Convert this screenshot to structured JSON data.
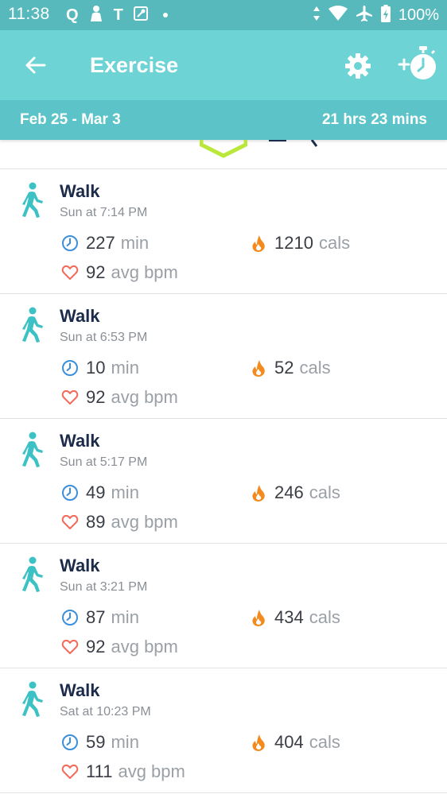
{
  "status_bar": {
    "time": "11:38",
    "left_glyphs": [
      "Q",
      "T"
    ],
    "battery": "100%"
  },
  "app_bar": {
    "title": "Exercise"
  },
  "week_summary": {
    "range": "Feb 25 - Mar 3",
    "total": "21 hrs 23 mins"
  },
  "units": {
    "duration": "min",
    "calories": "cals",
    "heart_rate": "avg bpm"
  },
  "colors": {
    "accent_teal": "#58b9bd",
    "app_bar": "#6dd3d4",
    "walk_icon": "#3cc1c4",
    "clock_icon": "#3b8fd9",
    "flame_icon": "#f28a1e",
    "heart_icon": "#f26b5b"
  },
  "exercises": [
    {
      "type": "Walk",
      "time": "Sun at 7:14 PM",
      "duration": "227",
      "calories": "1210",
      "bpm": "92"
    },
    {
      "type": "Walk",
      "time": "Sun at 6:53 PM",
      "duration": "10",
      "calories": "52",
      "bpm": "92"
    },
    {
      "type": "Walk",
      "time": "Sun at 5:17 PM",
      "duration": "49",
      "calories": "246",
      "bpm": "89"
    },
    {
      "type": "Walk",
      "time": "Sun at 3:21 PM",
      "duration": "87",
      "calories": "434",
      "bpm": "92"
    },
    {
      "type": "Walk",
      "time": "Sat at 10:23 PM",
      "duration": "59",
      "calories": "404",
      "bpm": "111"
    }
  ]
}
